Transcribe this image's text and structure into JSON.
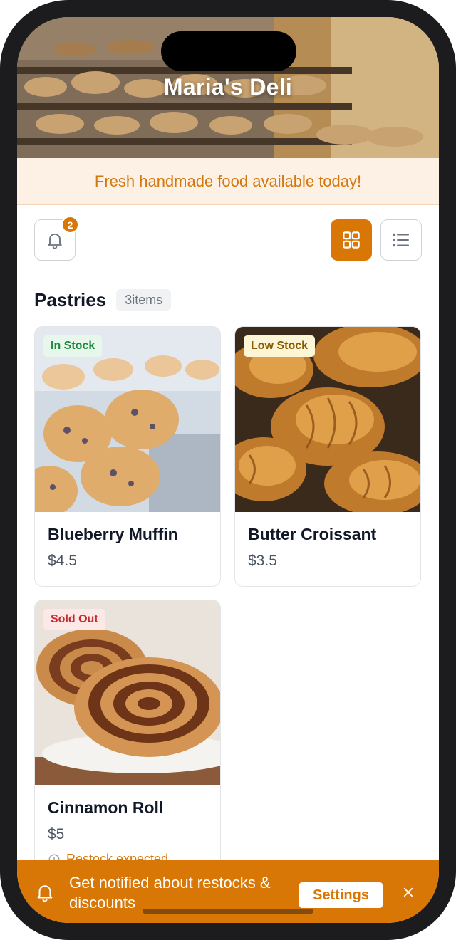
{
  "app": {
    "title": "Maria's Deli"
  },
  "banner": {
    "text": "Fresh handmade food available today!"
  },
  "toolbar": {
    "notifications_count": "2",
    "bell_icon": "bell-icon",
    "grid_icon": "grid-view-icon",
    "list_icon": "list-view-icon",
    "active_view": "grid"
  },
  "section": {
    "title": "Pastries",
    "count_label": "3items"
  },
  "products": [
    {
      "name": "Blueberry Muffin",
      "price": "$4.5",
      "stock": "In Stock"
    },
    {
      "name": "Butter Croissant",
      "price": "$3.5",
      "stock": "Low Stock"
    },
    {
      "name": "Cinnamon Roll",
      "price": "$5",
      "stock": "Sold Out",
      "restock_note": "Restock expected"
    }
  ],
  "toast": {
    "text": "Get notified about restocks & discounts",
    "button_label": "Settings"
  },
  "colors": {
    "accent": "#d97706",
    "banner_bg": "#fdf1e6",
    "in_stock": "#1f8a3b",
    "low_stock": "#8a5a00",
    "sold_out": "#c52b2b"
  }
}
